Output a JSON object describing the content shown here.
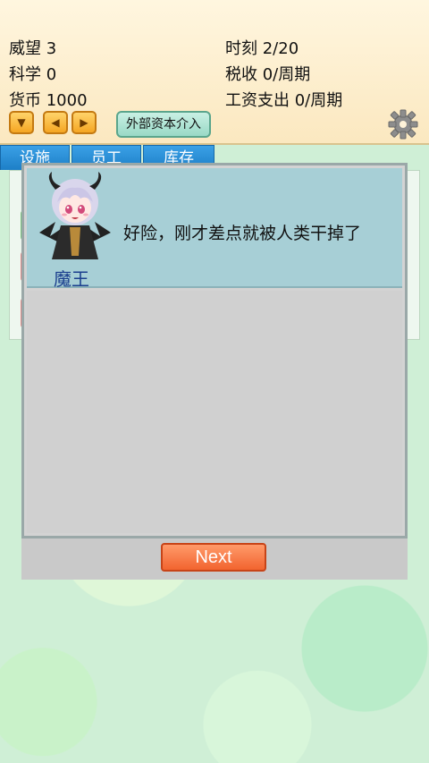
{
  "stats": {
    "reputation": "威望 3",
    "science": "科学 0",
    "currency": "货币 1000",
    "time": "时刻 2/20",
    "tax": "税收 0/周期",
    "wages": "工资支出 0/周期"
  },
  "controls": {
    "external_capital_label": "外部资本介入",
    "down_icon": "▼",
    "left_icon": "◀",
    "right_icon": "▶"
  },
  "tabs": [
    {
      "label": "设施"
    },
    {
      "label": "员工"
    },
    {
      "label": "库存"
    }
  ],
  "dialog": {
    "speaker": "魔王",
    "text": "好险，刚才差点就被人类干掉了",
    "next_label": "Next"
  },
  "colors": {
    "tab": "#1d7fc7",
    "next_button": "#f2642f",
    "speaker_box": "#a7cfd6",
    "speaker_name": "#1b3f8e"
  }
}
